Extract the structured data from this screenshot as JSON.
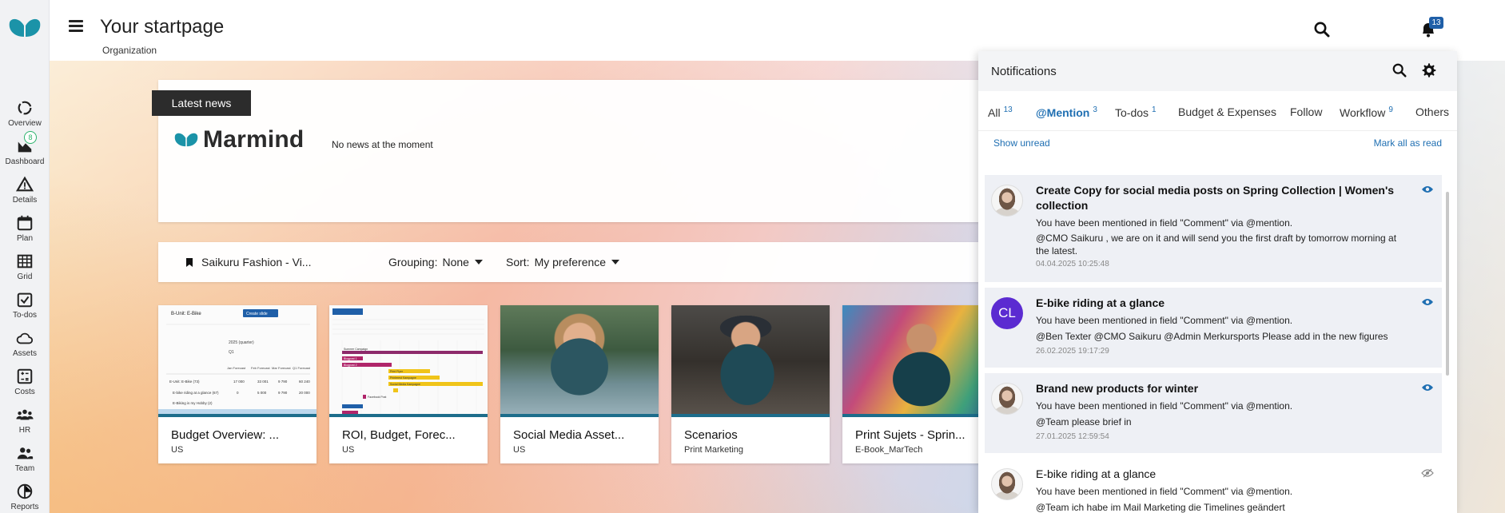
{
  "header": {
    "title": "Your startpage",
    "subtitle": "Organization",
    "notification_count": "13"
  },
  "sidebar": {
    "items": [
      {
        "label": "Overview",
        "icon": "overview-icon"
      },
      {
        "label": "Dashboard",
        "icon": "dashboard-icon",
        "badge": "8"
      },
      {
        "label": "Details",
        "icon": "details-icon"
      },
      {
        "label": "Plan",
        "icon": "calendar-icon"
      },
      {
        "label": "Grid",
        "icon": "grid-icon"
      },
      {
        "label": "To-dos",
        "icon": "todos-icon"
      },
      {
        "label": "Assets",
        "icon": "cloud-icon"
      },
      {
        "label": "Costs",
        "icon": "costs-icon"
      },
      {
        "label": "HR",
        "icon": "hr-icon"
      },
      {
        "label": "Team",
        "icon": "team-icon"
      },
      {
        "label": "Reports",
        "icon": "reports-icon"
      }
    ]
  },
  "news": {
    "tab_label": "Latest news",
    "logo_text": "Marmind",
    "empty_text": "No news at the moment"
  },
  "filters": {
    "bookmark": "Saikuru Fashion - Vi...",
    "grouping_label": "Grouping:",
    "grouping_value": "None",
    "sort_label": "Sort:",
    "sort_value": "My preference"
  },
  "tiles": [
    {
      "title": "Budget Overview: ...",
      "subtitle": "US"
    },
    {
      "title": "ROI, Budget, Forec...",
      "subtitle": "US"
    },
    {
      "title": "Social Media Asset...",
      "subtitle": "US"
    },
    {
      "title": "Scenarios",
      "subtitle": "Print Marketing"
    },
    {
      "title": "Print Sujets - Sprin...",
      "subtitle": "E-Book_MarTech"
    }
  ],
  "tile_thumbnail_text": {
    "sheet": {
      "unit": "B-Unit: E-Bike",
      "create": "Create slide",
      "period": "2025 (quarter)",
      "q": "Q1",
      "cols": [
        "Jan Forecast",
        "Feb Forecast",
        "Mar Forecast",
        "Q1 Forecast"
      ],
      "row1": [
        "E-Unit: E-Bike (73)",
        "17 000",
        "33 001",
        "9 790",
        "60 240"
      ],
      "row2": [
        "E-bike riding at a glance (67)",
        "0",
        "5 000",
        "9 790",
        "20 000"
      ],
      "row3": [
        "E-Biking is my Hobby (2)",
        "",
        "",
        "",
        ""
      ]
    },
    "gantt": {
      "bars": [
        "Summer Campaign",
        "Blogpost 1",
        "Blogpost 2",
        "Print Flyer",
        "Printerest Kampagne",
        "Social Media Kampagne",
        "Facebook Post"
      ]
    }
  },
  "notifications": {
    "title": "Notifications",
    "tabs": [
      {
        "label": "All",
        "count": "13"
      },
      {
        "label": "@Mention",
        "count": "3",
        "active": true
      },
      {
        "label": "To-dos",
        "count": "1"
      },
      {
        "label": "Budget & Expenses",
        "count": ""
      },
      {
        "label": "Follow",
        "count": ""
      },
      {
        "label": "Workflow",
        "count": "9"
      },
      {
        "label": "Others",
        "count": ""
      }
    ],
    "show_unread": "Show unread",
    "mark_all_read": "Mark all as read",
    "items": [
      {
        "title": "Create Copy for social media posts on Spring Collection | Women's collection",
        "line1": "You have been mentioned in field \"Comment\" via @mention.",
        "line2": "@CMO Saikuru , we are on it and will send you the first draft by tomorrow morning at the latest.",
        "date": "04.04.2025 10:25:48",
        "unread": true
      },
      {
        "title": "E-bike riding at a glance",
        "line1": "You have been mentioned in field \"Comment\" via @mention.",
        "line2": "@Ben Texter @CMO Saikuru @Admin Merkursports Please add in the new figures",
        "date": "26.02.2025 19:17:29",
        "initials": "CL",
        "unread": true
      },
      {
        "title": "Brand new products for winter",
        "line1": "You have been mentioned in field \"Comment\" via @mention.",
        "line2": "@Team please brief in",
        "date": "27.01.2025 12:59:54",
        "unread": true
      },
      {
        "title": "E-bike riding at a glance",
        "line1": "You have been mentioned in field \"Comment\" via @mention.",
        "line2": "@Team ich habe im Mail Marketing die Timelines geändert",
        "date": "",
        "unread": false
      }
    ]
  },
  "colors": {
    "accent": "#1f6fb2",
    "brand_teal": "#1b93a8",
    "badge_blue": "#1f5fa8",
    "unread_bg": "#eef0f5",
    "avatar_purple": "#5b2bd1"
  }
}
